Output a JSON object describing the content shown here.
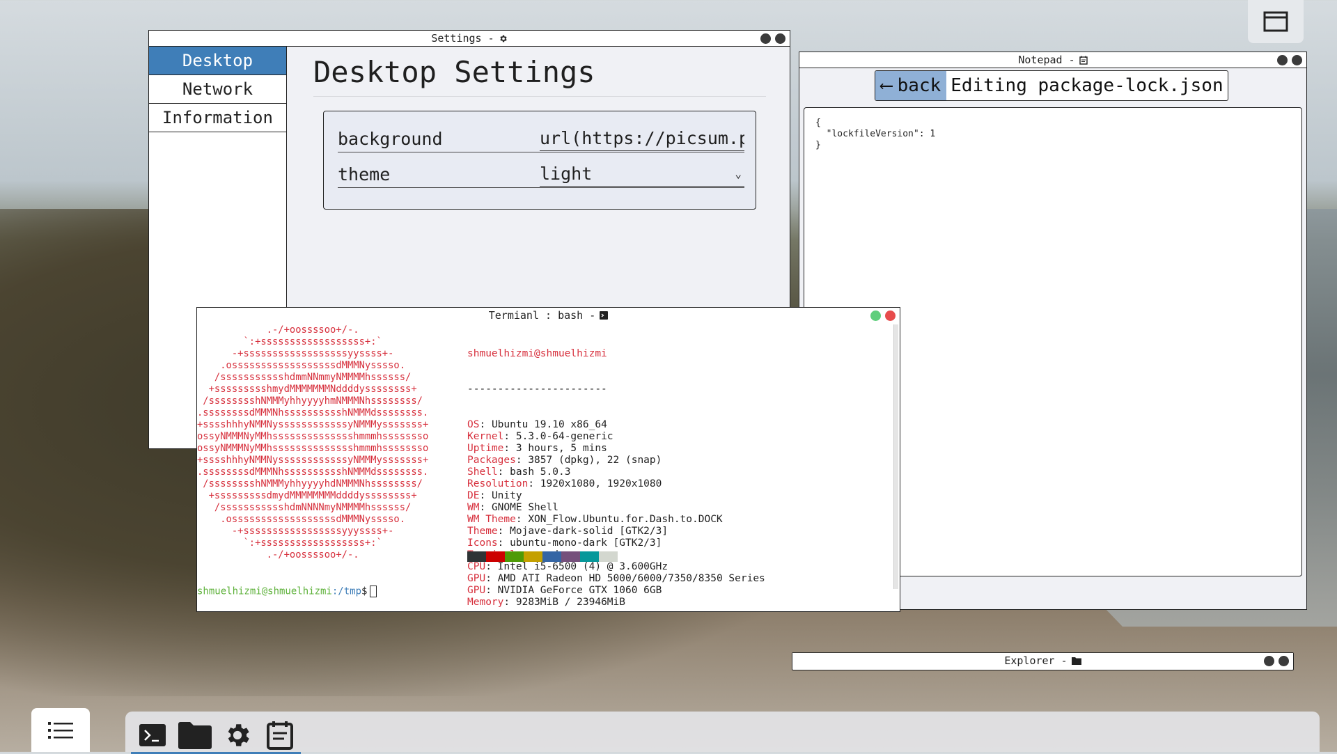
{
  "settings": {
    "title": "Settings -",
    "icon": "gear-icon",
    "sidebar": {
      "items": [
        {
          "label": "Desktop"
        },
        {
          "label": "Network"
        },
        {
          "label": "Information"
        }
      ]
    },
    "main": {
      "heading": "Desktop Settings",
      "background_label": "background",
      "background_value": "url(https://picsum.ph",
      "theme_label": "theme",
      "theme_value": "light"
    }
  },
  "notepad": {
    "title": "Notepad -",
    "icon": "notepad-icon",
    "back_label": "back",
    "editing_label": "Editing package-lock.json",
    "content": "{\n  \"lockfileVersion\": 1\n}"
  },
  "terminal": {
    "title": "Termianl : bash -",
    "icon": "terminal-icon",
    "ascii": [
      "            .-/+oossssoo+/-.",
      "        `:+ssssssssssssssssss+:`",
      "      -+ssssssssssssssssssyyssss+-",
      "    .ossssssssssssssssssdMMMNysssso.",
      "   /ssssssssssshdmmNNmmyNMMMMhssssss/",
      "  +ssssssssshmydMMMMMMMNddddyssssssss+",
      " /sssssssshNMMMyhhyyyyhmNMMMNhssssssss/",
      ".ssssssssdMMMNhsssssssssshNMMMdssssssss.",
      "+sssshhhyNMMNyssssssssssssyNMMMysssssss+",
      "ossyNMMMNyMMhsssssssssssssshmmmhssssssso",
      "ossyNMMMNyMMhsssssssssssssshmmmhssssssso",
      "+sssshhhyNMMNyssssssssssssyNMMMysssssss+",
      ".ssssssssdMMMNhsssssssssshNMMMdssssssss.",
      " /sssssssshNMMMyhhyyyyhdNMMMNhssssssss/",
      "  +sssssssssdmydMMMMMMMMddddyssssssss+",
      "   /ssssssssssshdmNNNNmyNMMMMhssssss/",
      "    .ossssssssssssssssssdMMMNysssso.",
      "      -+sssssssssssssssssyyyssss+-",
      "        `:+ssssssssssssssssss+:`",
      "            .-/+oossssoo+/-."
    ],
    "user_host": "shmuelhizmi@shmuelhizmi",
    "separator": "-----------------------",
    "info": [
      {
        "key": "OS",
        "value": "Ubuntu 19.10 x86_64"
      },
      {
        "key": "Kernel",
        "value": "5.3.0-64-generic"
      },
      {
        "key": "Uptime",
        "value": "3 hours, 5 mins"
      },
      {
        "key": "Packages",
        "value": "3857 (dpkg), 22 (snap)"
      },
      {
        "key": "Shell",
        "value": "bash 5.0.3"
      },
      {
        "key": "Resolution",
        "value": "1920x1080, 1920x1080"
      },
      {
        "key": "DE",
        "value": "Unity"
      },
      {
        "key": "WM",
        "value": "GNOME Shell"
      },
      {
        "key": "WM Theme",
        "value": "XON_Flow.Ubuntu.for.Dash.to.DOCK"
      },
      {
        "key": "Theme",
        "value": "Mojave-dark-solid [GTK2/3]"
      },
      {
        "key": "Icons",
        "value": "ubuntu-mono-dark [GTK2/3]"
      },
      {
        "key": "Terminal",
        "value": "vscode"
      },
      {
        "key": "CPU",
        "value": "Intel i5-6500 (4) @ 3.600GHz"
      },
      {
        "key": "GPU",
        "value": "AMD ATI Radeon HD 5000/6000/7350/8350 Series"
      },
      {
        "key": "GPU",
        "value": "NVIDIA GeForce GTX 1060 6GB"
      },
      {
        "key": "Memory",
        "value": "9283MiB / 23946MiB"
      }
    ],
    "palette": [
      "#2e3436",
      "#cc0000",
      "#4e9a06",
      "#c4a000",
      "#3465a4",
      "#75507b",
      "#06989a",
      "#d3d7cf"
    ],
    "prompt_user": "shmuelhizmi@shmuelhizmi",
    "prompt_path": ":/tmp",
    "prompt_symbol": "$"
  },
  "explorer": {
    "title": "Explorer -",
    "icon": "folder-icon"
  },
  "taskbar": {
    "items": [
      "terminal-icon",
      "folder-icon",
      "gear-icon",
      "notepad-icon"
    ]
  },
  "colors": {
    "accent": "#3f7eb8",
    "back_button": "#8fb0d6",
    "terminal_red": "#d7303d",
    "terminal_green": "#5fb23c"
  }
}
